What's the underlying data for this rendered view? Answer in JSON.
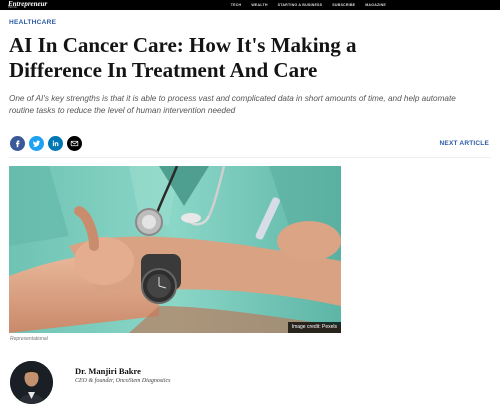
{
  "topbar": {
    "logo": "Entrepreneur",
    "logo_sub": "INDIA",
    "nav": [
      "TECH",
      "WEALTH",
      "STARTING A BUSINESS",
      "SUBSCRIBE",
      "MAGAZINE"
    ]
  },
  "section_label": "HEALTHCARE",
  "article": {
    "title": "AI In Cancer Care: How It's Making a Difference In Treatment And Care",
    "dek": "One of AI's key strengths is that it is able to process vast and complicated data in short amounts of time, and help automate routine tasks to reduce the level of human intervention needed"
  },
  "share": [
    {
      "name": "facebook-icon",
      "color": "#3b5998"
    },
    {
      "name": "twitter-icon",
      "color": "#1da1f2"
    },
    {
      "name": "linkedin-icon",
      "color": "#0077b5"
    },
    {
      "name": "email-icon",
      "color": "#000000"
    }
  ],
  "next_article": "NEXT ARTICLE",
  "image": {
    "credit": "Image credit: Pexels",
    "caption": "Representational",
    "scrubs_color": "#6dc8b7"
  },
  "author": {
    "name": "Dr. Manjiri Bakre",
    "role": "CEO & founder, OncoStem Diagnostics"
  }
}
